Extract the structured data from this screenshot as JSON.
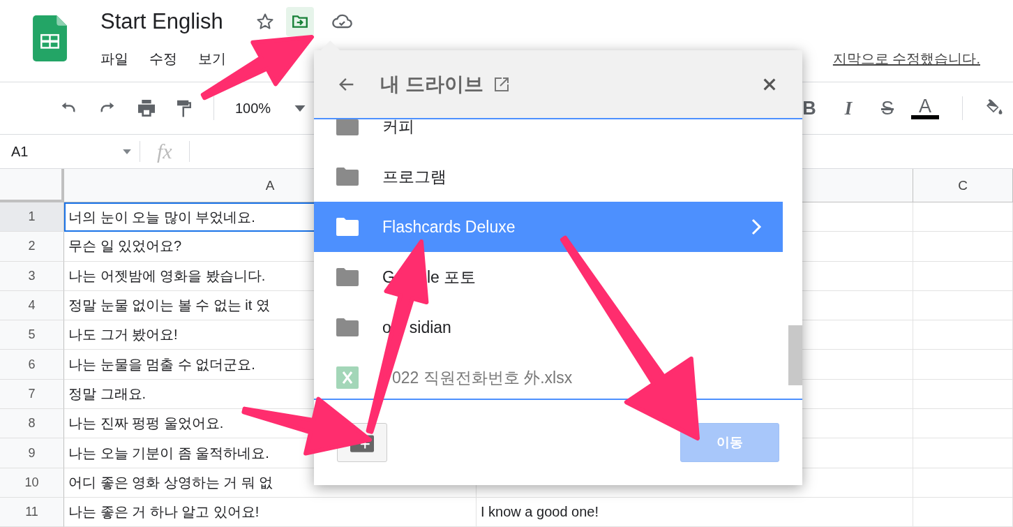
{
  "app": {
    "title": "Start English",
    "menus": [
      "파일",
      "수정",
      "보기"
    ],
    "last_edit": "지막으로 수정했습니다."
  },
  "toolbar": {
    "zoom": "100%",
    "format_buttons": [
      {
        "kind": "bold",
        "label": "B"
      },
      {
        "kind": "italic",
        "label": "I"
      },
      {
        "kind": "strike",
        "label": "S"
      },
      {
        "kind": "color",
        "label": "A"
      }
    ]
  },
  "formula_bar": {
    "cell_ref": "A1",
    "fx": "fx"
  },
  "grid": {
    "column_headers": {
      "a": "A",
      "c": "C"
    },
    "rows": [
      {
        "num": "1",
        "a": "너의 눈이 오늘 많이 부었네요.",
        "selected": true
      },
      {
        "num": "2",
        "a": "무슨 일 있었어요?",
        "selected": false
      },
      {
        "num": "3",
        "a": "나는 어젯밤에 영화을 봤습니다.",
        "selected": false
      },
      {
        "num": "4",
        "a": "정말 눈물 없이는 볼 수 없는 it 였",
        "selected": false
      },
      {
        "num": "5",
        "a": "나도 그거 봤어요!",
        "selected": false
      },
      {
        "num": "6",
        "a": "나는 눈물을 멈출 수 없더군요.",
        "selected": false
      },
      {
        "num": "7",
        "a": "정말 그래요.",
        "selected": false
      },
      {
        "num": "8",
        "a": "나는 진짜 펑펑 울었어요.",
        "selected": false
      },
      {
        "num": "9",
        "a": "나는 오늘 기분이 좀 울적하네요.",
        "selected": false
      },
      {
        "num": "10",
        "a": "어디 좋은 영화 상영하는 거 뭐 없",
        "selected": false
      },
      {
        "num": "11",
        "a": "나는 좋은 거 하나 알고 있어요!",
        "b": "I know a good one!",
        "selected": false
      }
    ]
  },
  "dialog": {
    "title": "내 드라이브",
    "items": [
      {
        "kind": "folder",
        "name_parts": [
          "커피"
        ],
        "selected": false
      },
      {
        "kind": "folder",
        "name_parts": [
          "프로그램"
        ],
        "selected": false
      },
      {
        "kind": "folder",
        "name_parts": [
          "Flashcards Deluxe"
        ],
        "selected": true
      },
      {
        "kind": "folder",
        "name_parts": [
          "G",
          "le 포토"
        ],
        "selected": false
      },
      {
        "kind": "folder",
        "name_parts": [
          "o",
          "sidian"
        ],
        "selected": false
      },
      {
        "kind": "file",
        "name_parts": [
          "022 직원전화번호 外.xlsx"
        ],
        "selected": false
      }
    ],
    "move_button": {
      "label": "이동",
      "disabled": true
    }
  }
}
